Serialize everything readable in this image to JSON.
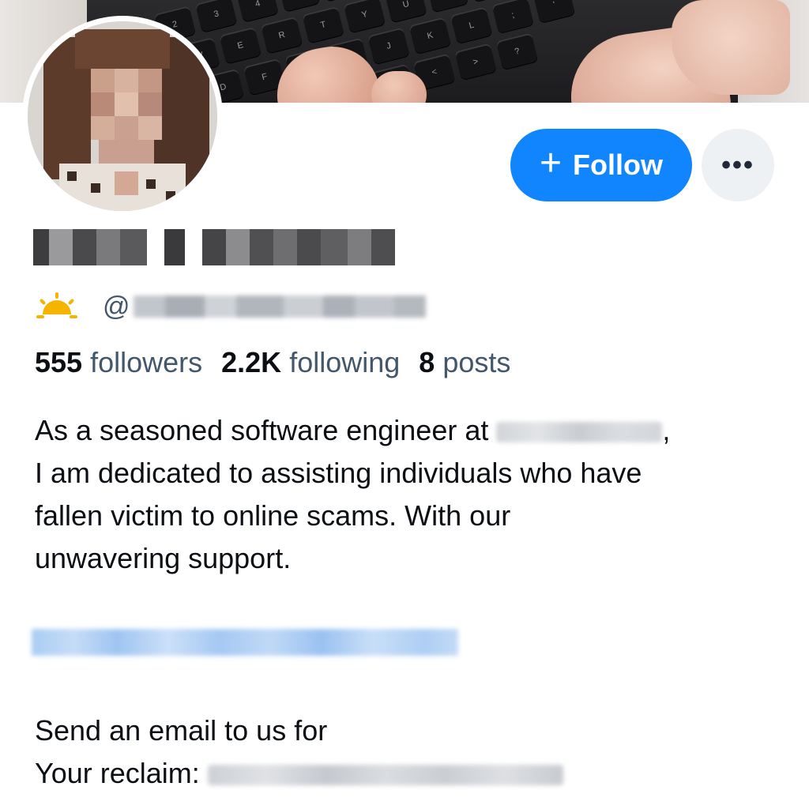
{
  "profile": {
    "follow_label": "Follow",
    "follow_icon": "+",
    "more_label": "•••",
    "handle_prefix": "@",
    "handle_emoji": "sun-icon",
    "accent_color": "#1185fe"
  },
  "stats": {
    "followers_count": "555",
    "followers_label": "followers",
    "following_count": "2.2K",
    "following_label": "following",
    "posts_count": "8",
    "posts_label": "posts"
  },
  "bio": {
    "line1": "As a seasoned software engineer at",
    "line1_end": ",",
    "line2": "I am dedicated to assisting individuals who have",
    "line3": "fallen victim to online scams. With our",
    "line4": "unwavering support."
  },
  "contact": {
    "line1": "Send an email to us for",
    "line2": "Your reclaim:"
  }
}
